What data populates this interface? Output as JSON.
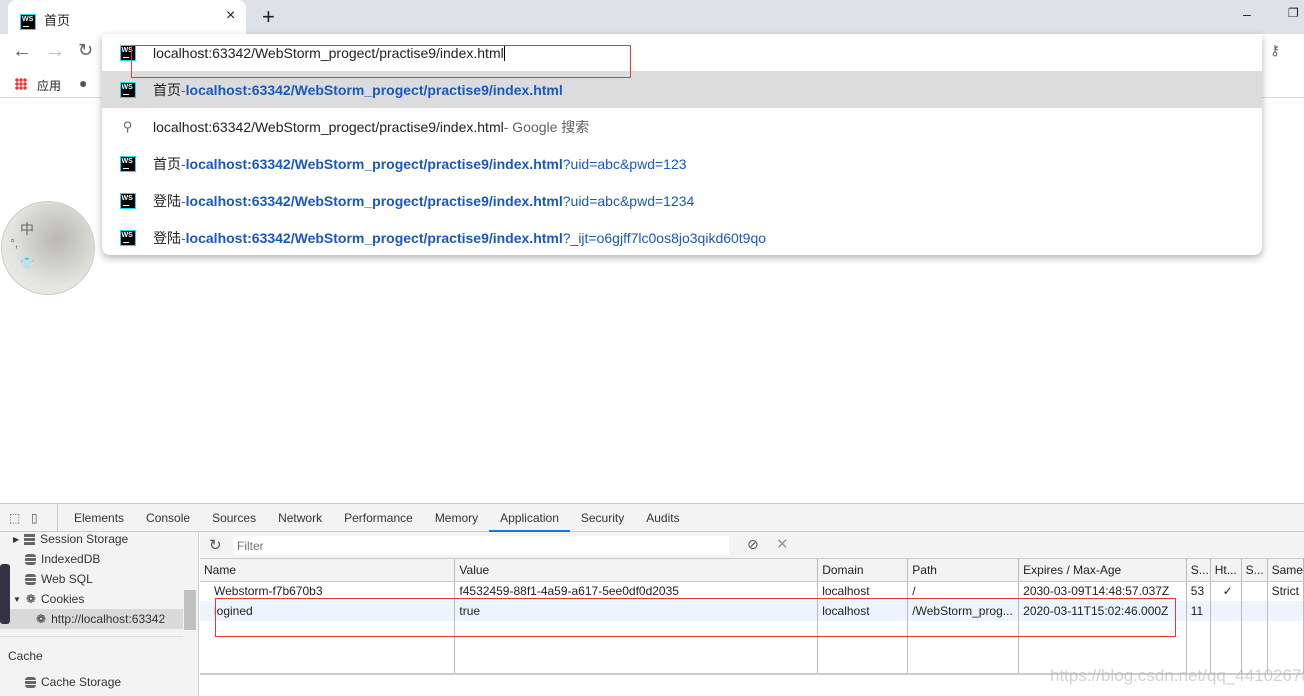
{
  "browser": {
    "tab_title": "首页",
    "new_tab": "+",
    "close": "×",
    "bookmark_apps": "应用"
  },
  "omnibox": {
    "value": "localhost:63342/WebStorm_progect/practise9/index.html",
    "suggestions": [
      {
        "icon": "webstorm-icon",
        "title": "首页",
        "sep": " - ",
        "url": "localhost:63342/WebStorm_progect/practise9/index.html",
        "suffix": ""
      },
      {
        "icon": "search-icon",
        "title": "",
        "sep": "",
        "url": "localhost:63342/WebStorm_progect/practise9/index.html",
        "suffix": " - Google 搜索"
      },
      {
        "icon": "webstorm-icon",
        "title": "首页",
        "sep": " - ",
        "url": "localhost:63342/WebStorm_progect/practise9/index.html",
        "suffix": "?uid=abc&pwd=123"
      },
      {
        "icon": "webstorm-icon",
        "title": "登陆",
        "sep": " - ",
        "url": "localhost:63342/WebStorm_progect/practise9/index.html",
        "suffix": "?uid=abc&pwd=1234"
      },
      {
        "icon": "webstorm-icon",
        "title": "登陆",
        "sep": " - ",
        "url": "localhost:63342/WebStorm_progect/practise9/index.html",
        "suffix": "?_ijt=o6gjff7lc0os8jo3qikd60t9qo"
      }
    ]
  },
  "page": {
    "avatar_chars": [
      "中",
      "°,",
      "👕"
    ]
  },
  "devtools": {
    "tabs": [
      "Elements",
      "Console",
      "Sources",
      "Network",
      "Performance",
      "Memory",
      "Application",
      "Security",
      "Audits"
    ],
    "active_tab": "Application",
    "sidebar": {
      "items": [
        "Session Storage",
        "IndexedDB",
        "Web SQL",
        "Cookies",
        "http://localhost:63342"
      ],
      "cache_header": "Cache",
      "cache_items": [
        "Cache Storage"
      ]
    },
    "filter_placeholder": "Filter",
    "columns": [
      "Name",
      "Value",
      "Domain",
      "Path",
      "Expires / Max-Age",
      "S...",
      "Ht...",
      "S...",
      "Same"
    ],
    "rows": [
      [
        "Webstorm-f7b670b3",
        "f4532459-88f1-4a59-a617-5ee0df0d2035",
        "localhost",
        "/",
        "2030-03-09T14:48:57.037Z",
        "53",
        "✓",
        "",
        "Strict"
      ],
      [
        "logined",
        "true",
        "localhost",
        "/WebStorm_prog...",
        "2020-03-11T15:02:46.000Z",
        "11",
        "",
        "",
        ""
      ]
    ]
  },
  "watermark": "https://blog.csdn.net/qq_44102678"
}
